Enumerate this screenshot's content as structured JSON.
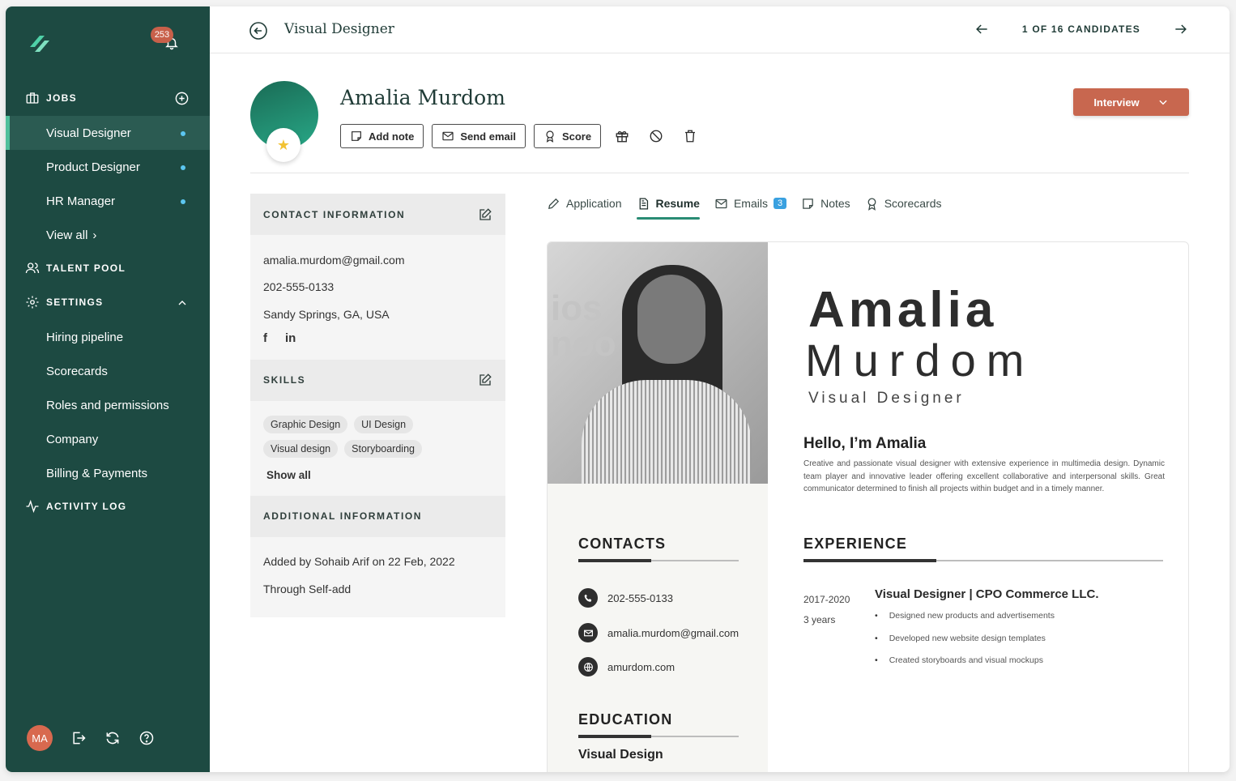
{
  "sidebar": {
    "notification_count": "253",
    "jobs_label": "JOBS",
    "jobs": [
      {
        "label": "Visual Designer"
      },
      {
        "label": "Product Designer"
      },
      {
        "label": "HR Manager"
      }
    ],
    "view_all": "View all",
    "talent_pool_label": "TALENT POOL",
    "settings_label": "SETTINGS",
    "settings_items": [
      {
        "label": "Hiring pipeline"
      },
      {
        "label": "Scorecards"
      },
      {
        "label": "Roles and permissions"
      },
      {
        "label": "Company"
      },
      {
        "label": "Billing & Payments"
      }
    ],
    "activity_log_label": "ACTIVITY LOG",
    "user_initials": "MA"
  },
  "topbar": {
    "job_title": "Visual Designer",
    "candidate_position": "1 OF 16 CANDIDATES"
  },
  "candidate": {
    "name": "Amalia Murdom",
    "actions": {
      "add_note": "Add note",
      "send_email": "Send email",
      "score": "Score"
    },
    "stage": "Interview"
  },
  "contact_info": {
    "heading": "CONTACT INFORMATION",
    "email": "amalia.murdom@gmail.com",
    "phone": "202-555-0133",
    "location": "Sandy Springs, GA, USA",
    "facebook_glyph": "f",
    "linkedin_glyph": "in"
  },
  "skills": {
    "heading": "SKILLS",
    "items": [
      "Graphic Design",
      "UI Design",
      "Visual design",
      "Storyboarding"
    ],
    "show_all": "Show all"
  },
  "additional_info": {
    "heading": "ADDITIONAL INFORMATION",
    "added_by": "Added by Sohaib Arif on 22 Feb, 2022",
    "source": "Through Self-add"
  },
  "tabs": [
    {
      "label": "Application"
    },
    {
      "label": "Resume",
      "active": true
    },
    {
      "label": "Emails",
      "count": "3"
    },
    {
      "label": "Notes"
    },
    {
      "label": "Scorecards"
    }
  ],
  "resume": {
    "photo_bg_text": [
      "ios",
      "noo"
    ],
    "first_name": "Amalia",
    "last_name": "Murdom",
    "role": "Visual Designer",
    "hello": "Hello, I’m Amalia",
    "summary": "Creative and passionate visual designer with extensive experience in multimedia design. Dynamic team player and innovative leader offering excellent collaborative and interpersonal skills. Great communicator determined to finish all projects within budget and in a timely manner.",
    "contacts_heading": "CONTACTS",
    "contacts": [
      "202-555-0133",
      "amalia.murdom@gmail.com",
      "amurdom.com"
    ],
    "education_heading": "EDUCATION",
    "education_title": "Visual Design",
    "experience_heading": "EXPERIENCE",
    "experience": {
      "period": "2017-2020",
      "duration": "3 years",
      "title": "Visual Designer | CPO Commerce LLC.",
      "bullets": [
        "Designed new products and advertisements",
        "Developed new website design templates",
        "Created storyboards and visual mockups"
      ]
    }
  },
  "colors": {
    "sidebar_bg": "#1d4a42",
    "accent": "#2a8c74",
    "stage_button": "#c8674f",
    "notification_badge": "#c8604a",
    "nav_dot": "#5cc6f0",
    "email_count_badge": "#3aa1e0"
  },
  "icons": [
    "logo-icon",
    "bell-icon",
    "briefcase-icon",
    "plus-circle-icon",
    "users-icon",
    "gear-icon",
    "chevron-up-icon",
    "activity-icon",
    "logout-icon",
    "refresh-icon",
    "help-icon",
    "back-circle-icon",
    "arrow-left-icon",
    "arrow-right-icon",
    "note-icon",
    "mail-icon",
    "award-icon",
    "gift-icon",
    "block-icon",
    "trash-icon",
    "edit-icon",
    "pencil-icon",
    "document-icon",
    "phone-icon",
    "globe-icon",
    "star-icon"
  ]
}
